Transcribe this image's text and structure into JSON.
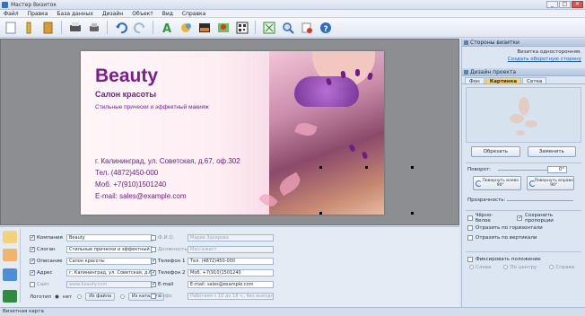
{
  "window": {
    "title": "Мастер Визиток",
    "buttons": [
      "_",
      "□",
      "✕"
    ]
  },
  "menu": [
    "Файл",
    "Правка",
    "База данных",
    "Дизайн",
    "Объект",
    "Вид",
    "Справка"
  ],
  "toolbar": {
    "icons": [
      "new-file-icon",
      "open-icon",
      "save-icon",
      "print-icon",
      "undo-icon",
      "redo-icon",
      "text-icon",
      "shape-icon",
      "image-icon",
      "map-icon",
      "qr-icon",
      "fit-icon",
      "zoom-icon",
      "cut-icon",
      "help-icon"
    ]
  },
  "card": {
    "brand": "Beauty",
    "salon": "Салон красоты",
    "desc": "Стильные прически и эффектный макияж",
    "address": "г. Калининград, ул. Советская, д.67, оф.302",
    "phone": "Тел. (4872)450-000",
    "mobile": "Моб. +7(910)1501240",
    "email": "E-mail: sales@example.com",
    "accent": "#7a1e8e"
  },
  "right": {
    "sides_header": "Стороны визитки",
    "sides_text": "Визитка односторонняя.",
    "sides_link": "Создать оборотную сторону",
    "design_header": "Дизайн проекта",
    "tabs": [
      "Фон",
      "Картинка",
      "Сетка"
    ],
    "active_tab": "Картинка",
    "crop": "Обрезать",
    "replace": "Заменить",
    "rotation_label": "Поворот:",
    "rotation_value": "0°",
    "rot_left": "Повернуть влево 90°",
    "rot_right": "Повернуть вправо 90°",
    "transparency_label": "Прозрачность:",
    "bw": "Чёрно-белое",
    "keep_ratio": "Сохранить пропорции",
    "flip_h": "Отразить по горизонтали",
    "flip_v": "Отразить по вертикали",
    "fixed": "Фиксировать положение",
    "align": [
      "Слева",
      "По центру",
      "Справа"
    ]
  },
  "form": {
    "col1": [
      {
        "label": "Компания",
        "value": "Beauty",
        "checked": true
      },
      {
        "label": "Слоган",
        "value": "Стильные прически и эффектный макияж",
        "checked": true
      },
      {
        "label": "Описание",
        "value": "Салон красоты",
        "checked": true
      },
      {
        "label": "Адрес",
        "value": "г. Калининград, ул. Советская, д.67, оф.302",
        "checked": true
      },
      {
        "label": "Сайт",
        "value": "www.beauty.com",
        "checked": false
      }
    ],
    "col2": [
      {
        "label": "Ф.И.О.",
        "value": "Мария Захарова",
        "checked": false
      },
      {
        "label": "Должность",
        "value": "Массажист",
        "checked": false
      },
      {
        "label": "Телефон 1",
        "value": "Тел. (4872)450-000",
        "checked": true
      },
      {
        "label": "Телефон 2",
        "value": "Моб. +7(910)1501240",
        "checked": true
      },
      {
        "label": "E-mail",
        "value": "E-mail: sales@example.com",
        "checked": true
      },
      {
        "label": "Инфо",
        "value": "Работаем с 10 до 18 ч., без выходных",
        "checked": false
      }
    ],
    "logo_label": "Логотип",
    "logo_none": "нет",
    "logo_file": "Из файла",
    "logo_catalog": "Из каталога"
  },
  "status": "Визитная карта"
}
